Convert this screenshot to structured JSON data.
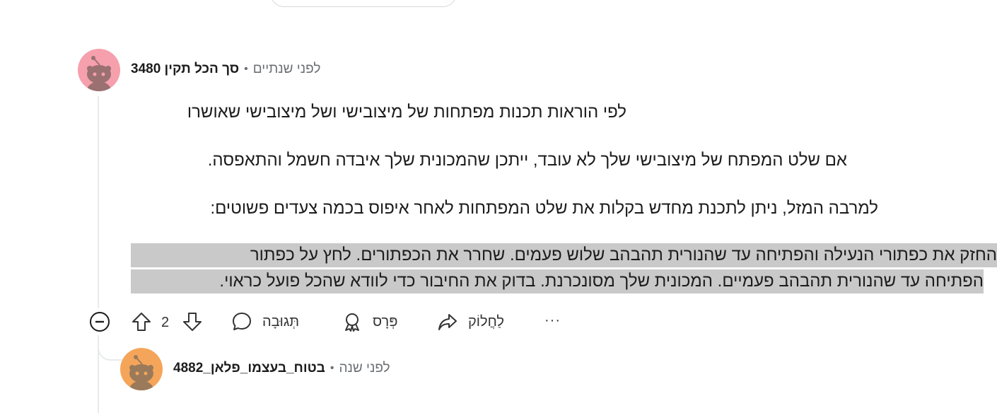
{
  "comment": {
    "username": "סך הכל תקין 3480",
    "separator": "•",
    "time": "לפני שנתיים",
    "paragraphs": [
      "לפי הוראות תכנות מפתחות של מיצובישי ושל מיצובישי שאושרו",
      "אם שלט המפתח של מיצובישי שלך לא עובד, ייתכן שהמכונית שלך איבדה חשמל והתאפסה.",
      "למרבה המזל, ניתן לתכנת מחדש בקלות את שלט המפתחות לאחר איפוס בכמה צעדים פשוטים:"
    ],
    "highlighted_lines": [
      "החזק את כפתורי הנעילה והפתיחה עד שהנורית תהבהב שלוש פעמים. שחרר את הכפתורים. לחץ על כפתור",
      "הפתיחה עד שהנורית תהבהב פעמיים. המכונית שלך מסונכרנת. בדוק את החיבור כדי לוודא שהכל פועל כראוי."
    ],
    "avatar_color": "#f5a0ac",
    "actions": {
      "vote_count": "2",
      "reply_label": "תְּגוּבָה",
      "award_label": "פְּרָס",
      "share_label": "לַחֲלוֹק",
      "more_label": "···"
    }
  },
  "reply": {
    "username": "בטוח_בעצמו_פלאן_4882",
    "separator": "•",
    "time": "לפני שנה",
    "avatar_color": "#f5a55a"
  },
  "colors": {
    "highlight": "#c9c9c9",
    "muted_text": "#6b6f73",
    "thread_line": "#e8eaec"
  }
}
